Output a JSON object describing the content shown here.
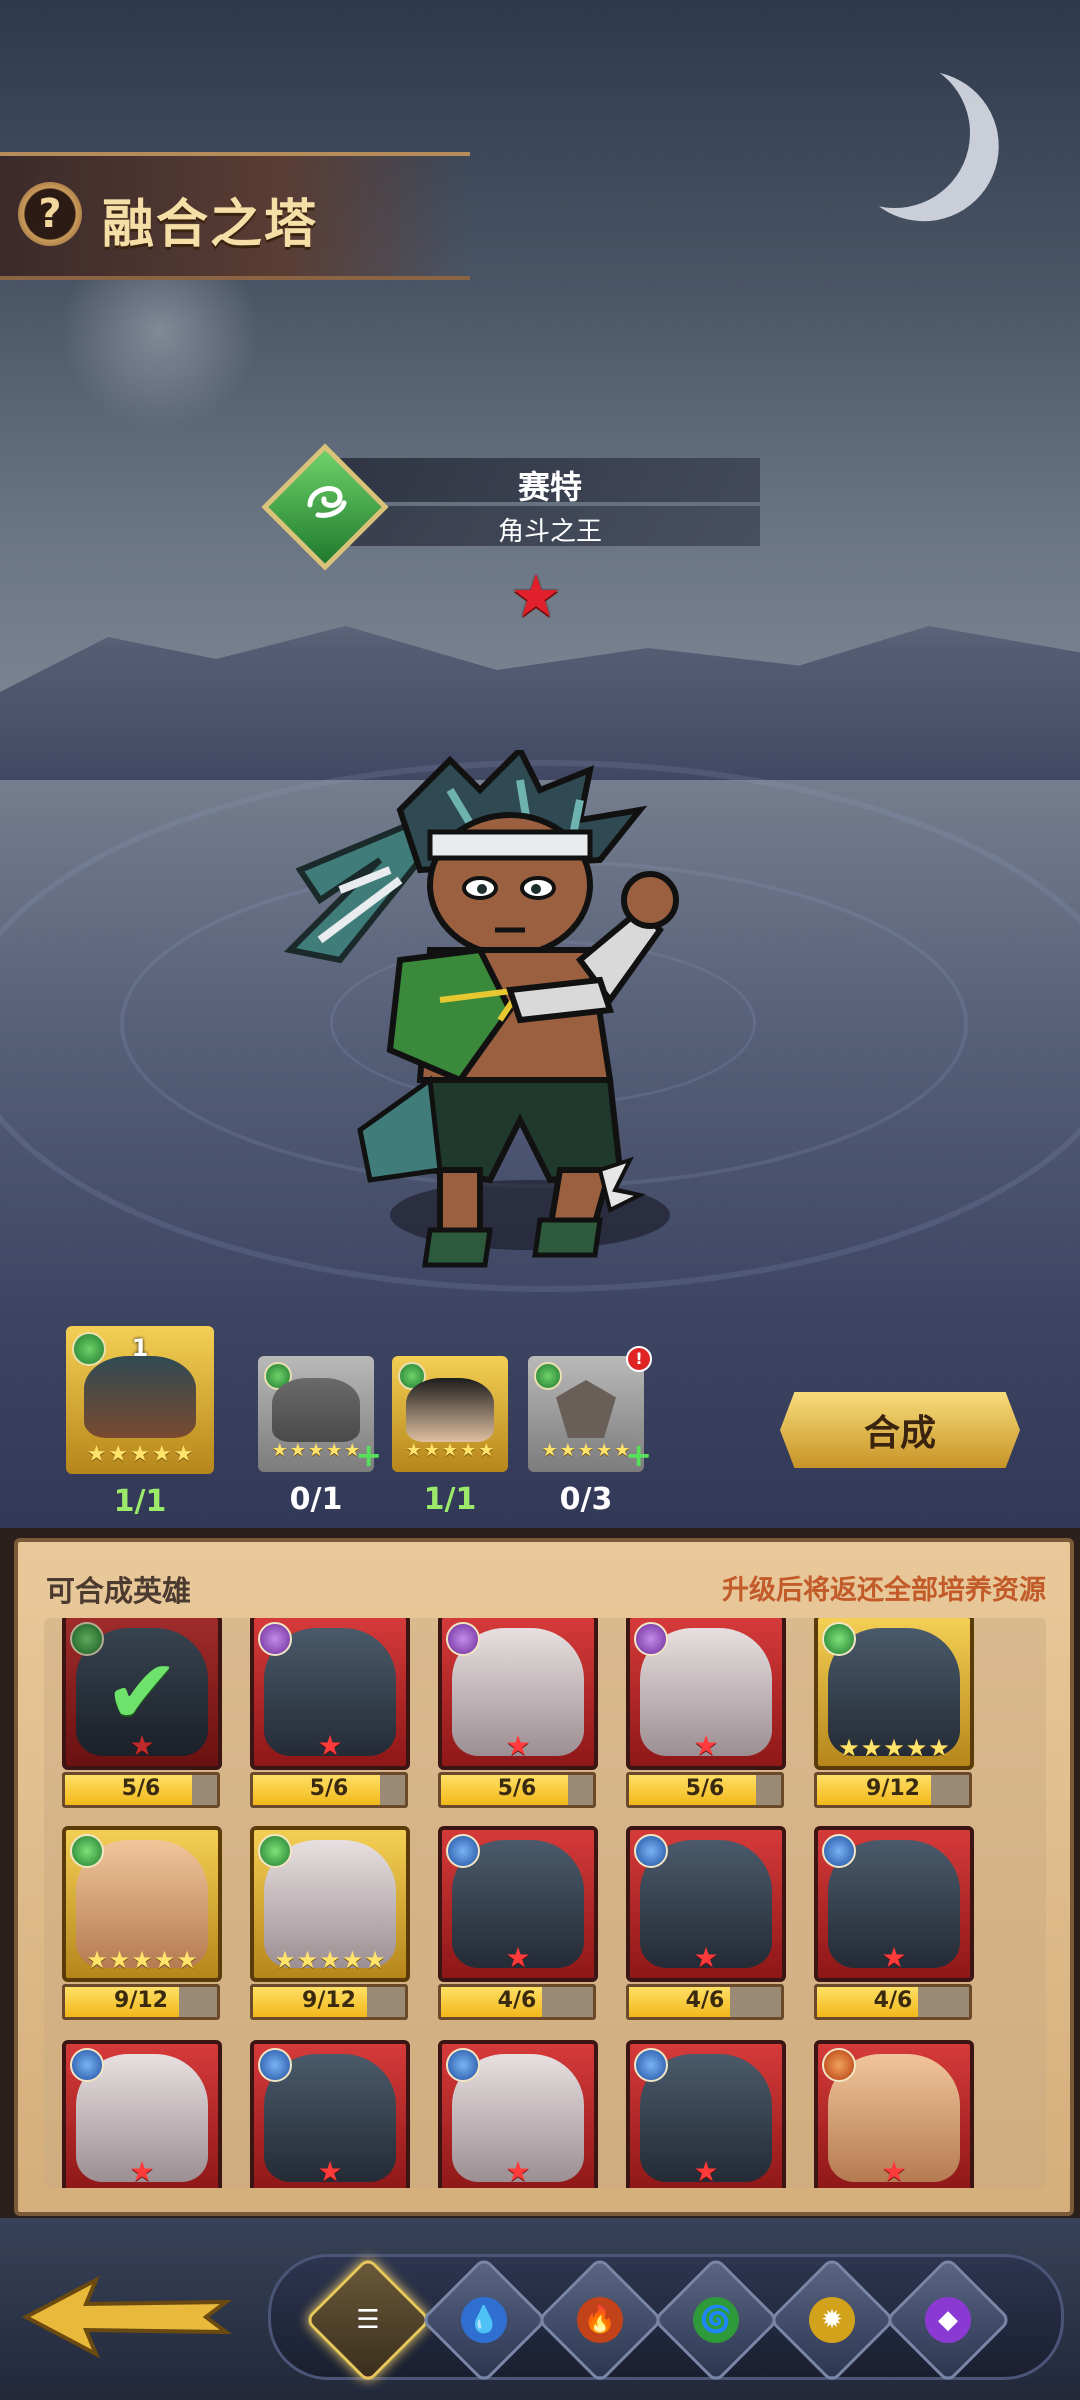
{
  "header": {
    "help_glyph": "?",
    "title": "融合之塔"
  },
  "hero": {
    "name": "赛特",
    "title": "角斗之王",
    "element": "nature",
    "star_glyph": "★",
    "stars": 1
  },
  "materials": [
    {
      "progress": "1/1",
      "type": "hero",
      "tier": "gold",
      "stars": 5,
      "quantity_label": "1",
      "complete": true
    },
    {
      "progress": "0/1",
      "type": "hero",
      "tier": "grey",
      "stars": 5,
      "add": true,
      "complete": false
    },
    {
      "progress": "1/1",
      "type": "hero",
      "tier": "gold",
      "stars": 5,
      "complete": true
    },
    {
      "progress": "0/3",
      "type": "any-nature",
      "tier": "grey",
      "stars": 5,
      "add": true,
      "alert": "!",
      "complete": false
    }
  ],
  "fuse_button": {
    "label": "合成"
  },
  "panel": {
    "title": "可合成英雄",
    "note": "升级后将返还全部培养资源",
    "heroes": [
      {
        "element": "nature",
        "rarity": "red",
        "progress": "5/6",
        "fill": 0.833,
        "selected": true,
        "face": "dark"
      },
      {
        "element": "void",
        "rarity": "red",
        "progress": "5/6",
        "fill": 0.833,
        "face": "dark"
      },
      {
        "element": "void",
        "rarity": "red",
        "progress": "5/6",
        "fill": 0.833,
        "face": "light"
      },
      {
        "element": "void",
        "rarity": "red",
        "progress": "5/6",
        "fill": 0.833,
        "face": "light"
      },
      {
        "element": "nature",
        "rarity": "gold",
        "progress": "9/12",
        "fill": 0.75,
        "face": "dark"
      },
      {
        "element": "nature",
        "rarity": "gold",
        "progress": "9/12",
        "fill": 0.75,
        "face": "skin"
      },
      {
        "element": "nature",
        "rarity": "gold",
        "progress": "9/12",
        "fill": 0.75,
        "face": "light"
      },
      {
        "element": "water",
        "rarity": "red",
        "progress": "4/6",
        "fill": 0.667,
        "face": "dark"
      },
      {
        "element": "water",
        "rarity": "red",
        "progress": "4/6",
        "fill": 0.667,
        "face": "dark"
      },
      {
        "element": "water",
        "rarity": "red",
        "progress": "4/6",
        "fill": 0.667,
        "face": "dark"
      },
      {
        "element": "water",
        "rarity": "red",
        "face": "light"
      },
      {
        "element": "water",
        "rarity": "red",
        "face": "dark"
      },
      {
        "element": "water",
        "rarity": "red",
        "face": "light"
      },
      {
        "element": "water",
        "rarity": "red",
        "face": "dark"
      },
      {
        "element": "fire",
        "rarity": "red",
        "face": "skin"
      }
    ]
  },
  "bottom_bar": {
    "back": "back-arrow-icon",
    "filters": [
      {
        "icon": "all-list-icon",
        "glyph": "☰",
        "active": true
      },
      {
        "icon": "water-icon",
        "glyph": "💧"
      },
      {
        "icon": "fire-icon",
        "glyph": "🔥"
      },
      {
        "icon": "nature-icon",
        "glyph": "🌀"
      },
      {
        "icon": "light-icon",
        "glyph": "✹"
      },
      {
        "icon": "void-icon",
        "glyph": "◆"
      }
    ]
  },
  "colors": {
    "gold": "#f4cf54",
    "red_card": "#d63a3a",
    "accent_text": "#c25a2a",
    "complete_count": "#9bea6a"
  }
}
